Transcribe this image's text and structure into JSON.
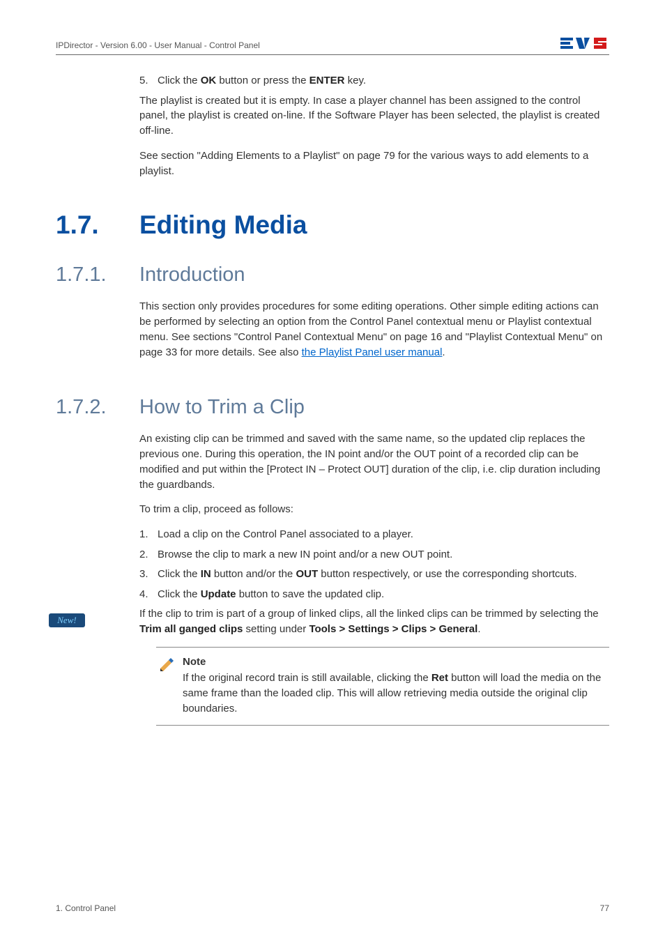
{
  "header": {
    "left": "IPDirector - Version 6.00 - User Manual - Control Panel",
    "logo_alt": "EVS"
  },
  "pre_section": {
    "step5_num": "5.",
    "step5_text_before": "Click the ",
    "step5_ok": "OK",
    "step5_text_mid": " button or press the ",
    "step5_enter": "ENTER",
    "step5_text_after": " key.",
    "para1": "The playlist is created but it is empty. In case a player channel has been assigned to the control panel, the playlist is created on-line. If the Software Player has been selected, the playlist is created off-line.",
    "para2": "See section \"Adding Elements to a Playlist\" on page 79 for the various ways to add elements to a playlist."
  },
  "h1": {
    "num": "1.7.",
    "text": "Editing Media"
  },
  "intro": {
    "num": "1.7.1.",
    "title": "Introduction",
    "para_before_link": "This section only provides procedures for some editing operations. Other simple editing actions can be performed by selecting an option from the Control Panel contextual menu or Playlist contextual menu. See sections \"Control Panel Contextual Menu\" on page 16 and \"Playlist Contextual Menu\" on page 33 for more details. See also ",
    "link_text": "the Playlist Panel user manual",
    "para_after_link": "."
  },
  "trim": {
    "num": "1.7.2.",
    "title": "How to Trim a Clip",
    "para1": "An existing clip can be trimmed and saved with the same name, so the updated clip replaces the previous one. During this operation, the IN point and/or the OUT point of a recorded clip can be modified and put within the [Protect IN – Protect OUT] duration of the clip, i.e. clip duration including the guardbands.",
    "para2": "To trim a clip, proceed as follows:",
    "steps": [
      {
        "n": "1.",
        "t": "Load a clip on the Control Panel associated to a player."
      },
      {
        "n": "2.",
        "t": "Browse the clip to mark a new IN point and/or a new OUT point."
      }
    ],
    "step3_n": "3.",
    "step3_before": "Click the ",
    "step3_in": "IN",
    "step3_mid": " button and/or the ",
    "step3_out": "OUT",
    "step3_after": " button respectively, or use the corresponding shortcuts.",
    "step4_n": "4.",
    "step4_before": "Click the ",
    "step4_update": "Update",
    "step4_after": " button to save the updated clip.",
    "linked_before": "If the clip to trim is part of a group of linked clips, all the linked clips can be trimmed by selecting the ",
    "linked_bold1": "Trim all ganged clips",
    "linked_mid": " setting under ",
    "linked_bold2": "Tools > Settings > Clips > General",
    "linked_after": "."
  },
  "note": {
    "title": "Note",
    "before_ret": "If the original record train is still available, clicking the ",
    "ret": "Ret",
    "after_ret": " button will load the media on the same frame than the loaded clip. This will allow retrieving media outside the original clip boundaries."
  },
  "new_badge": "New!",
  "footer": {
    "left": "1. Control Panel",
    "right": "77"
  }
}
